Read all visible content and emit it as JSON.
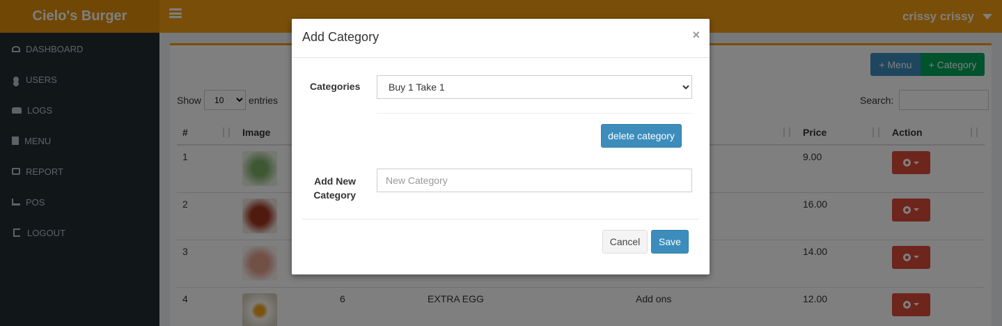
{
  "header": {
    "brand": "Cielo's Burger",
    "user_name": "crissy crissy"
  },
  "sidebar": {
    "items": [
      {
        "label": "DASHBOARD",
        "icon": "dashboard-icon"
      },
      {
        "label": "USERS",
        "icon": "user-icon"
      },
      {
        "label": "LOGS",
        "icon": "users-icon"
      },
      {
        "label": "MENU",
        "icon": "file-icon"
      },
      {
        "label": "REPORT",
        "icon": "print-icon"
      },
      {
        "label": "POS",
        "icon": "cart-icon"
      },
      {
        "label": "LOGOUT",
        "icon": "sign-out-icon"
      }
    ]
  },
  "toolbar": {
    "menu_button": "+ Menu",
    "category_button": "+ Category"
  },
  "list_controls": {
    "show_label": "Show",
    "show_value": "10",
    "entries_label": "entries",
    "search_label": "Search:"
  },
  "table": {
    "headers": [
      "#",
      "Image",
      "",
      "",
      "",
      "Price",
      "Action"
    ],
    "rows": [
      {
        "num": "1",
        "id": "",
        "name": "",
        "category": "",
        "price": "9.00",
        "image": "green-food"
      },
      {
        "num": "2",
        "id": "",
        "name": "",
        "category": "",
        "price": "16.00",
        "image": "bacon"
      },
      {
        "num": "3",
        "id": "",
        "name": "",
        "category": "",
        "price": "14.00",
        "image": "ham"
      },
      {
        "num": "4",
        "id": "6",
        "name": "EXTRA EGG",
        "category": "Add ons",
        "price": "12.00",
        "image": "egg"
      }
    ]
  },
  "modal": {
    "title": "Add Category",
    "close": "×",
    "categories_label": "Categories",
    "categories_selected": "Buy 1 Take 1",
    "delete_button": "delete category",
    "new_label_line1": "Add New",
    "new_label_line2": "Category",
    "new_placeholder": "New Category",
    "cancel_button": "Cancel",
    "save_button": "Save"
  },
  "colors": {
    "header": "#f39c12",
    "brand": "#e08e0b",
    "sidebar": "#222d32",
    "primary": "#3c8dbc",
    "success": "#00a65a",
    "danger": "#dd4b39"
  }
}
